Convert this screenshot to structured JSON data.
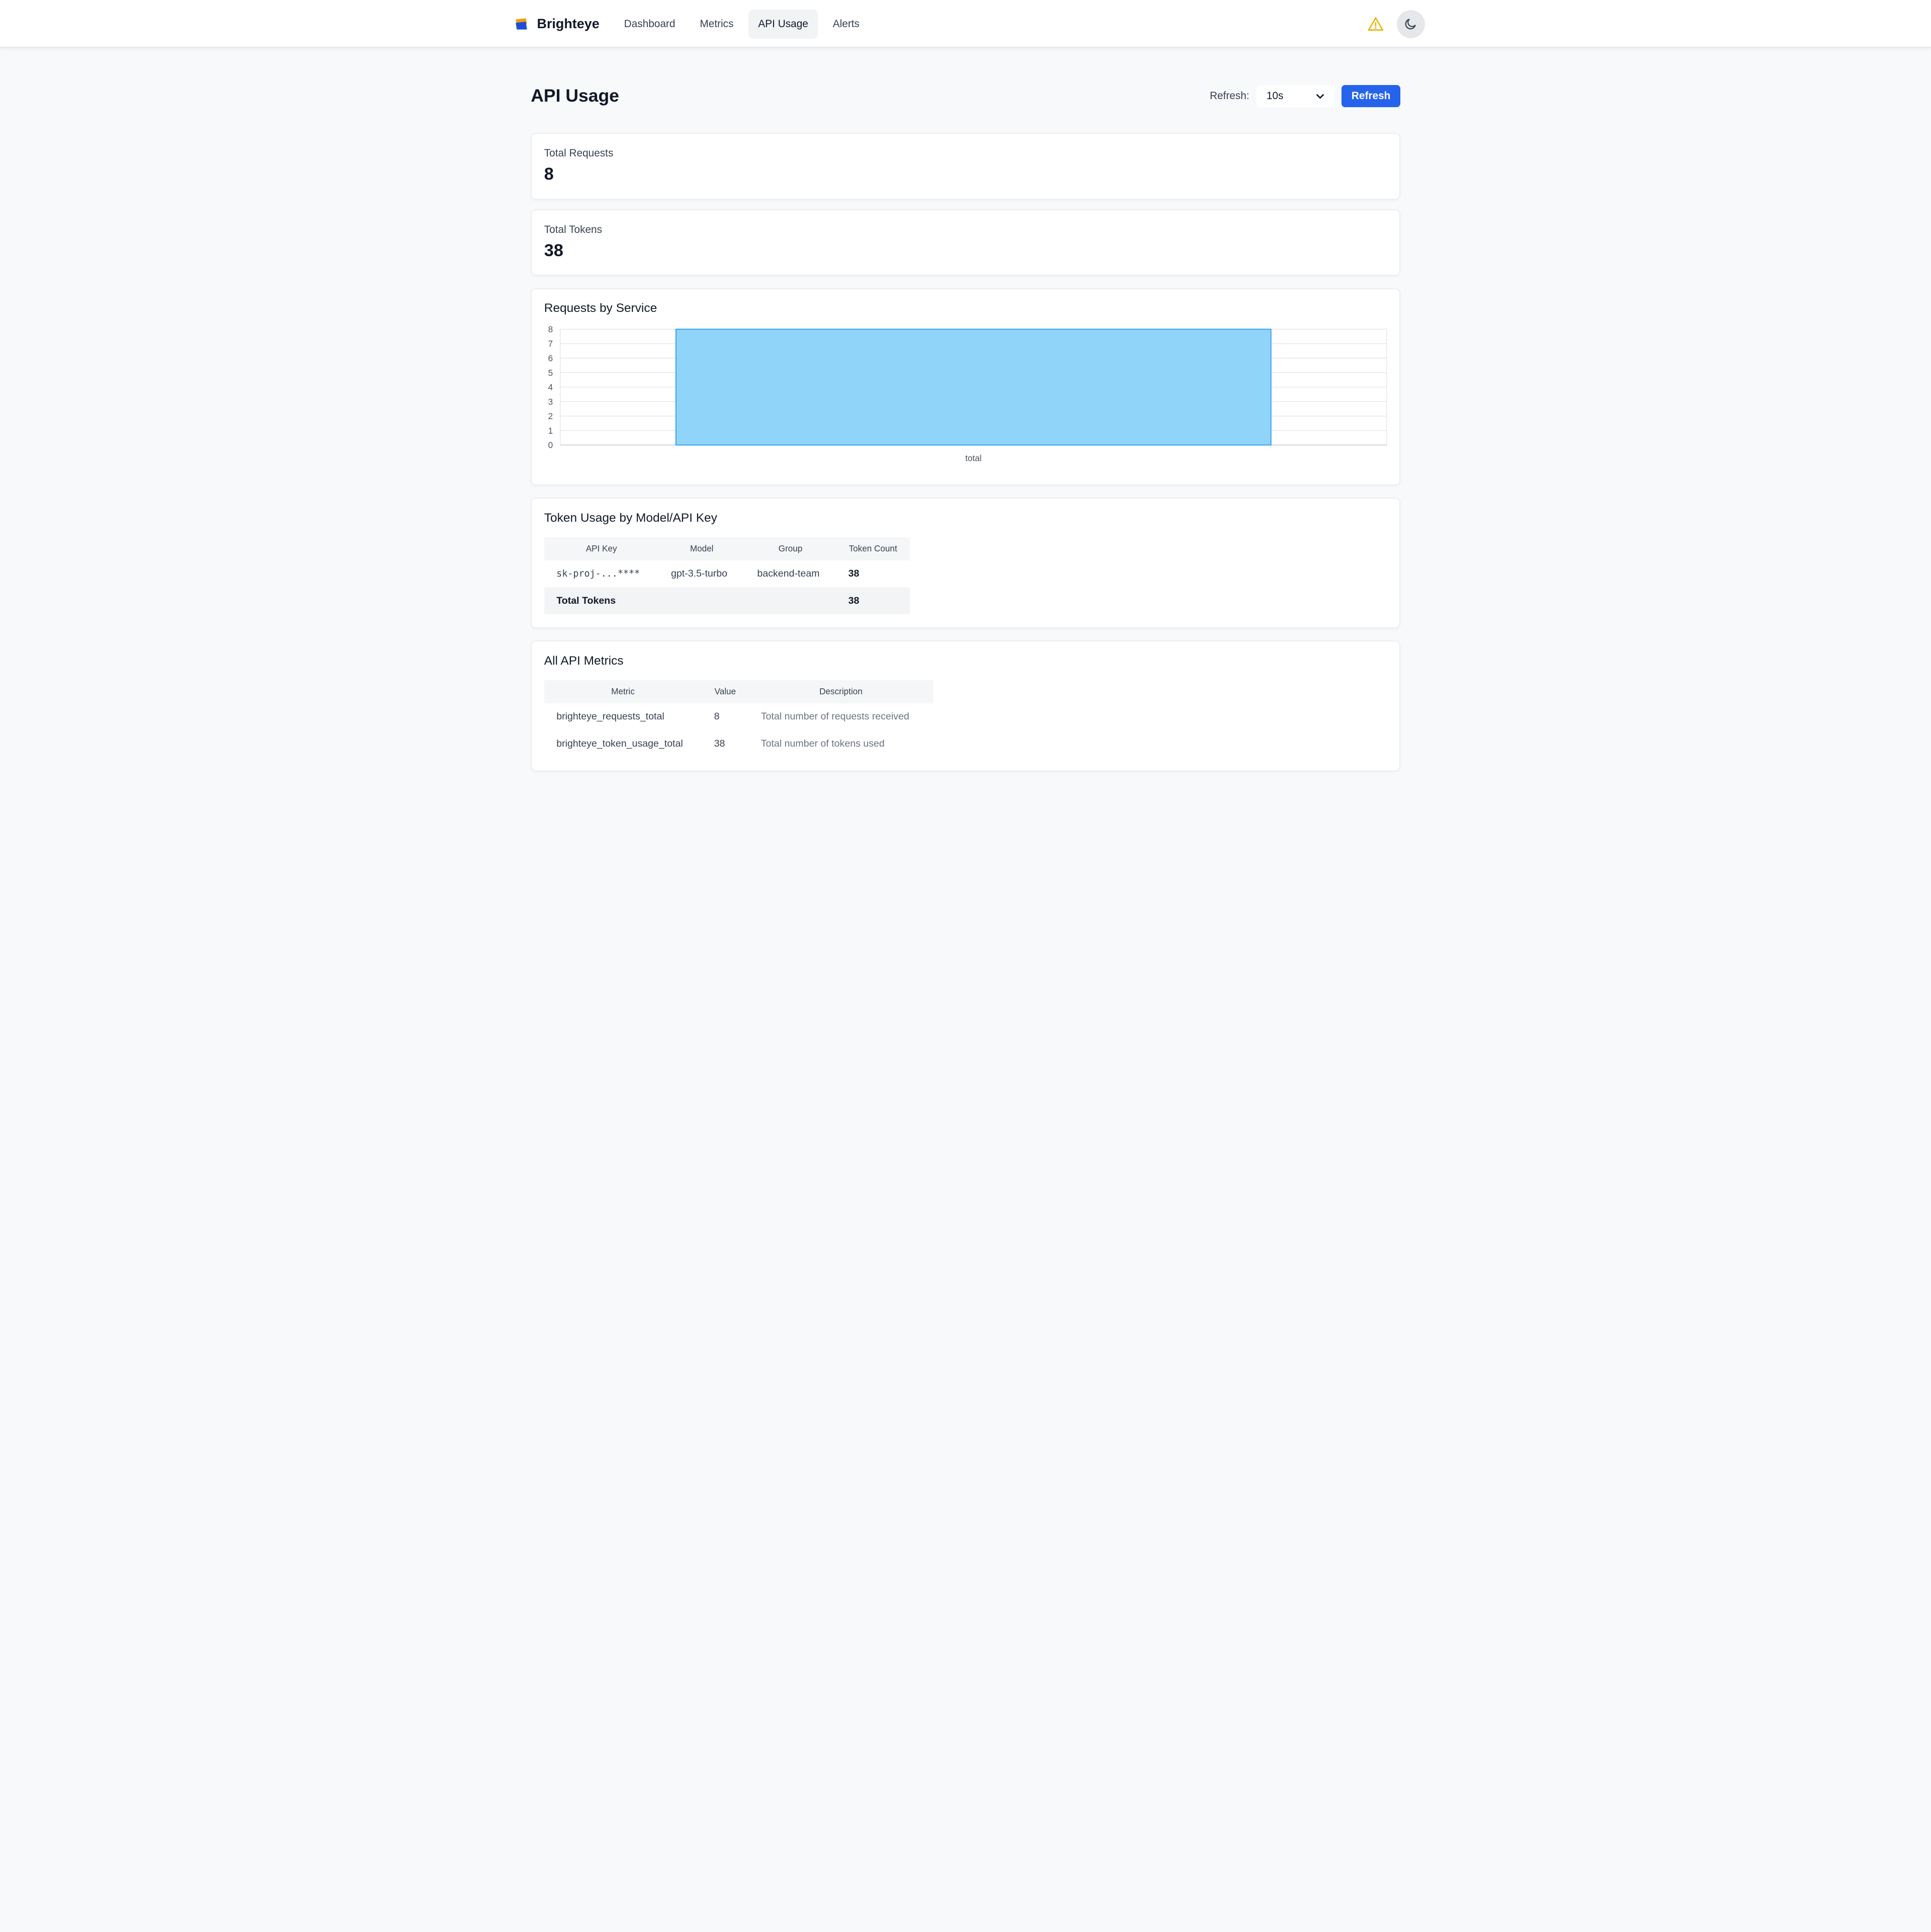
{
  "brand": {
    "name": "Brighteye"
  },
  "nav": {
    "items": [
      {
        "label": "Dashboard"
      },
      {
        "label": "Metrics"
      },
      {
        "label": "API Usage",
        "active": true
      },
      {
        "label": "Alerts"
      }
    ]
  },
  "page": {
    "title": "API Usage",
    "refresh_label": "Refresh:",
    "refresh_interval": "10s",
    "refresh_button": "Refresh"
  },
  "stats": {
    "total_requests_label": "Total Requests",
    "total_requests_value": "8",
    "total_tokens_label": "Total Tokens",
    "total_tokens_value": "38"
  },
  "requests_chart": {
    "title": "Requests by Service"
  },
  "chart_data": {
    "type": "bar",
    "categories": [
      "total"
    ],
    "values": [
      8
    ],
    "title": "Requests by Service",
    "xlabel": "",
    "ylabel": "",
    "ylim": [
      0,
      8
    ],
    "yticks": [
      0,
      1,
      2,
      3,
      4,
      5,
      6,
      7,
      8
    ],
    "grid": true,
    "bar_color": "#90d5f9",
    "bar_border": "#36a2eb"
  },
  "token_table": {
    "title": "Token Usage by Model/API Key",
    "headers": [
      "API Key",
      "Model",
      "Group",
      "Token Count"
    ],
    "rows": [
      {
        "api_key": "sk-proj-...****",
        "model": "gpt-3.5-turbo",
        "group": "backend-team",
        "count": "38"
      }
    ],
    "total_label": "Total Tokens",
    "total_value": "38"
  },
  "metrics_table": {
    "title": "All API Metrics",
    "headers": [
      "Metric",
      "Value",
      "Description"
    ],
    "rows": [
      {
        "metric": "brighteye_requests_total",
        "value": "8",
        "description": "Total number of requests received"
      },
      {
        "metric": "brighteye_token_usage_total",
        "value": "38",
        "description": "Total number of tokens used"
      }
    ]
  },
  "colors": {
    "accent": "#2563eb",
    "warning": "#eab308"
  },
  "icons": {
    "logo": "brighteye-logo-icon",
    "alert": "warning-triangle-icon",
    "theme": "moon-icon",
    "select": "chevron-down-icon"
  }
}
